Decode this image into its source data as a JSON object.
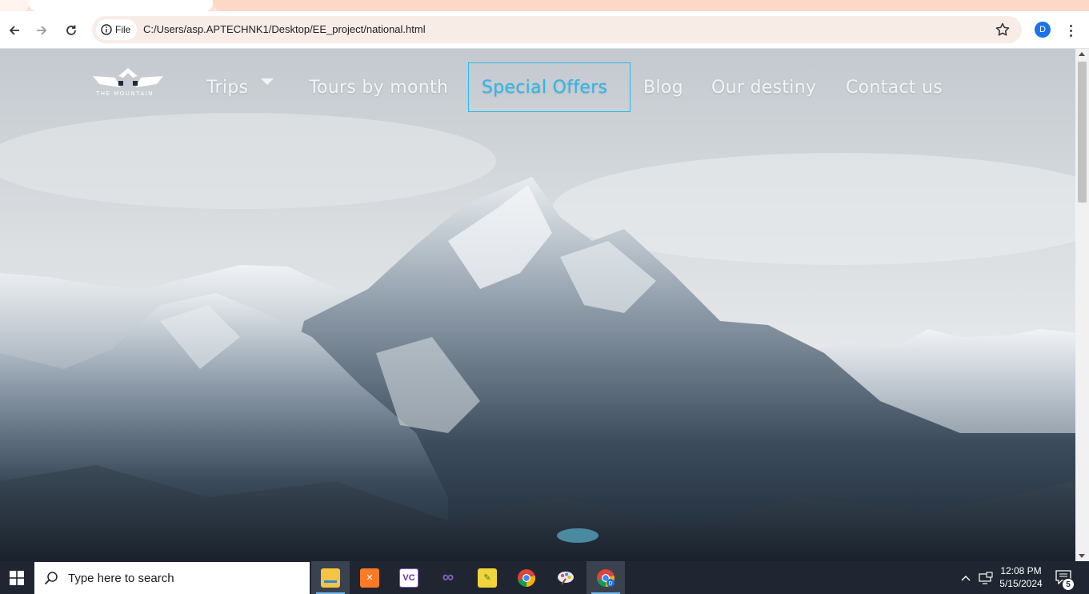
{
  "browser": {
    "site_chip_label": "File",
    "url": "C:/Users/asp.APTECHNK1/Desktop/EE_project/national.html",
    "profile_initial": "D"
  },
  "site": {
    "logo_text": "THE MOUNTAIN",
    "nav": {
      "trips": "Trips",
      "tours_by_month": "Tours by month",
      "special_offers": "Special Offers",
      "blog": "Blog",
      "our_destiny": "Our destiny",
      "contact_us": "Contact us"
    },
    "active_nav": "Special Offers",
    "active_color": "#2ab6ea"
  },
  "taskbar": {
    "search_placeholder": "Type here to search",
    "apps": [
      "file-explorer",
      "xampp",
      "visual-studio-code-variant",
      "visual-studio",
      "app-installer",
      "google-chrome",
      "paint",
      "google-chrome-profile"
    ],
    "time": "12:08 PM",
    "date": "5/15/2024",
    "notification_count": "5"
  }
}
